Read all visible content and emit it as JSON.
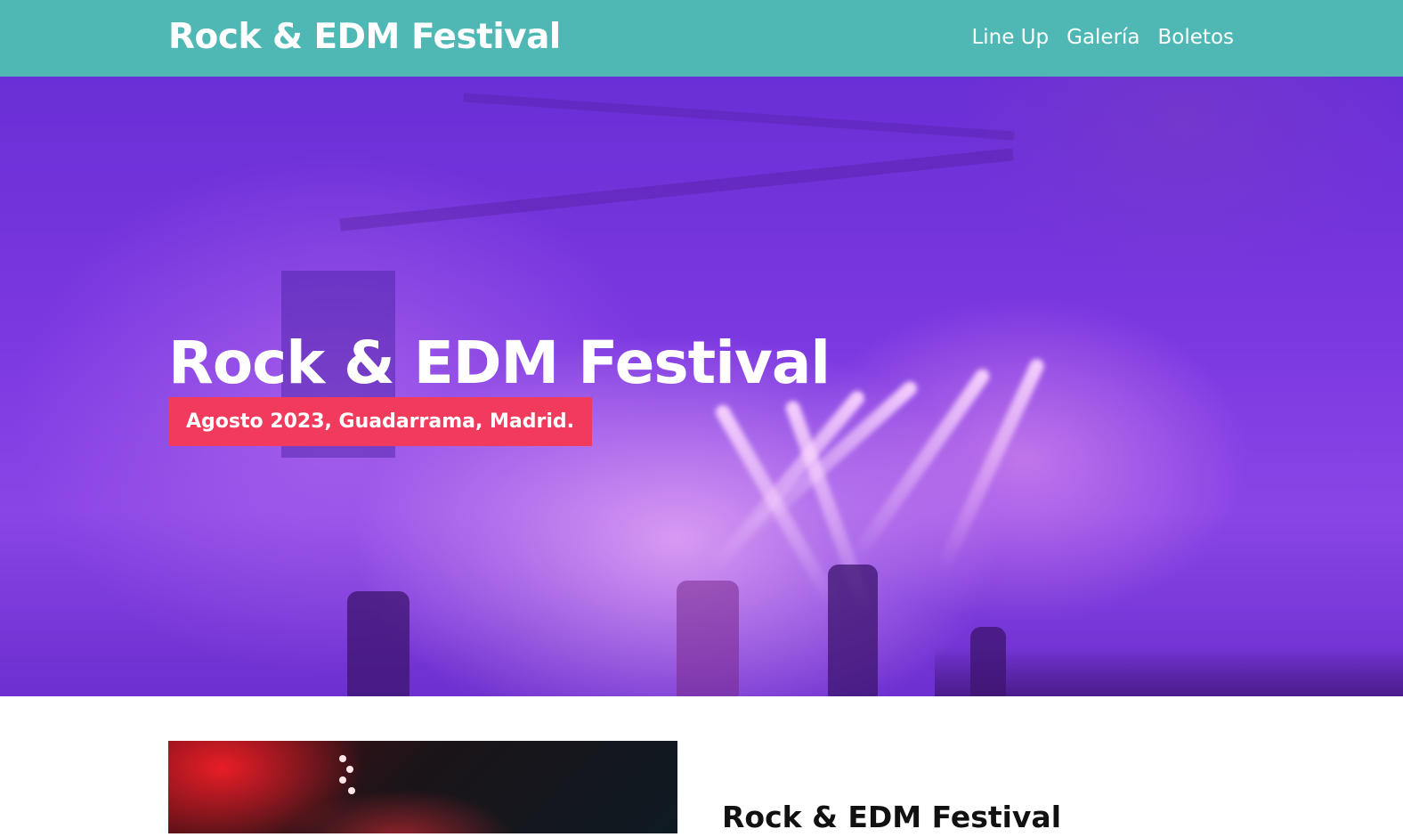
{
  "header": {
    "logo": "Rock & EDM Festival",
    "nav": [
      {
        "label": "Line Up"
      },
      {
        "label": "Galería"
      },
      {
        "label": "Boletos"
      }
    ]
  },
  "hero": {
    "title": "Rock & EDM Festival",
    "badge": "Agosto 2023, Guadarrama, Madrid."
  },
  "content": {
    "title": "Rock & EDM Festival"
  },
  "colors": {
    "header_bg": "#4fb8b5",
    "badge_bg": "#f23a5c",
    "hero_tint": "#7b37e0"
  }
}
